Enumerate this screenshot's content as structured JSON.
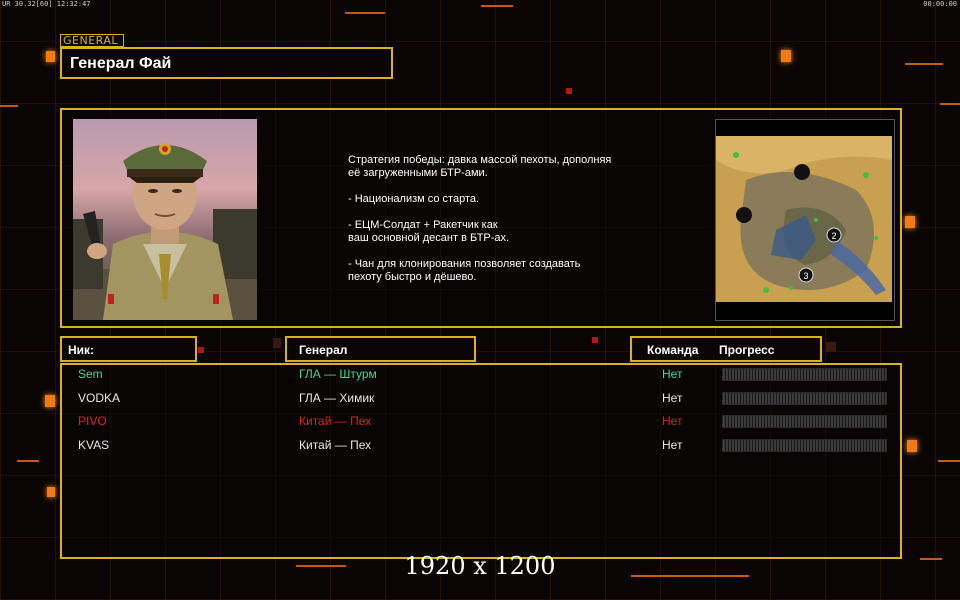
{
  "hud": {
    "left": "UR 30.32[60] 12:32:47",
    "right": "00:00:00"
  },
  "header": {
    "tag": "GENERAL",
    "title": "Генерал Фай"
  },
  "info": {
    "description": "Стратегия победы: давка массой пехоты, дополняя\n её загруженными БТР-ами.\n\n- Национализм со старта.\n\n- ЕЦМ-Солдат + Ракетчик как\nваш основной десант в БТР-ах.\n\n- Чан для клонирования позволяет создавать\n пехоту быстро и дёшево.",
    "minimap_markers": [
      "2",
      "3"
    ]
  },
  "columns": {
    "nick": "Ник:",
    "general": "Генерал",
    "team": "Команда",
    "progress": "Прогресс"
  },
  "players": [
    {
      "nick": "Sem",
      "general": "ГЛА — Штурм",
      "team": "Нет",
      "color": "#3fd98a"
    },
    {
      "nick": "VODKA",
      "general": "ГЛА — Химик",
      "team": "Нет",
      "color": "#e8e8e8"
    },
    {
      "nick": "PIVO",
      "general": "Китай — Пех",
      "team": "Нет",
      "color": "#e02020"
    },
    {
      "nick": "KVAS",
      "general": "Китай — Пех",
      "team": "Нет",
      "color": "#e8e8e8"
    }
  ],
  "resolution": "1920 x 1200",
  "colors": {
    "accent": "#d8b41a",
    "orange": "#f07a18"
  }
}
